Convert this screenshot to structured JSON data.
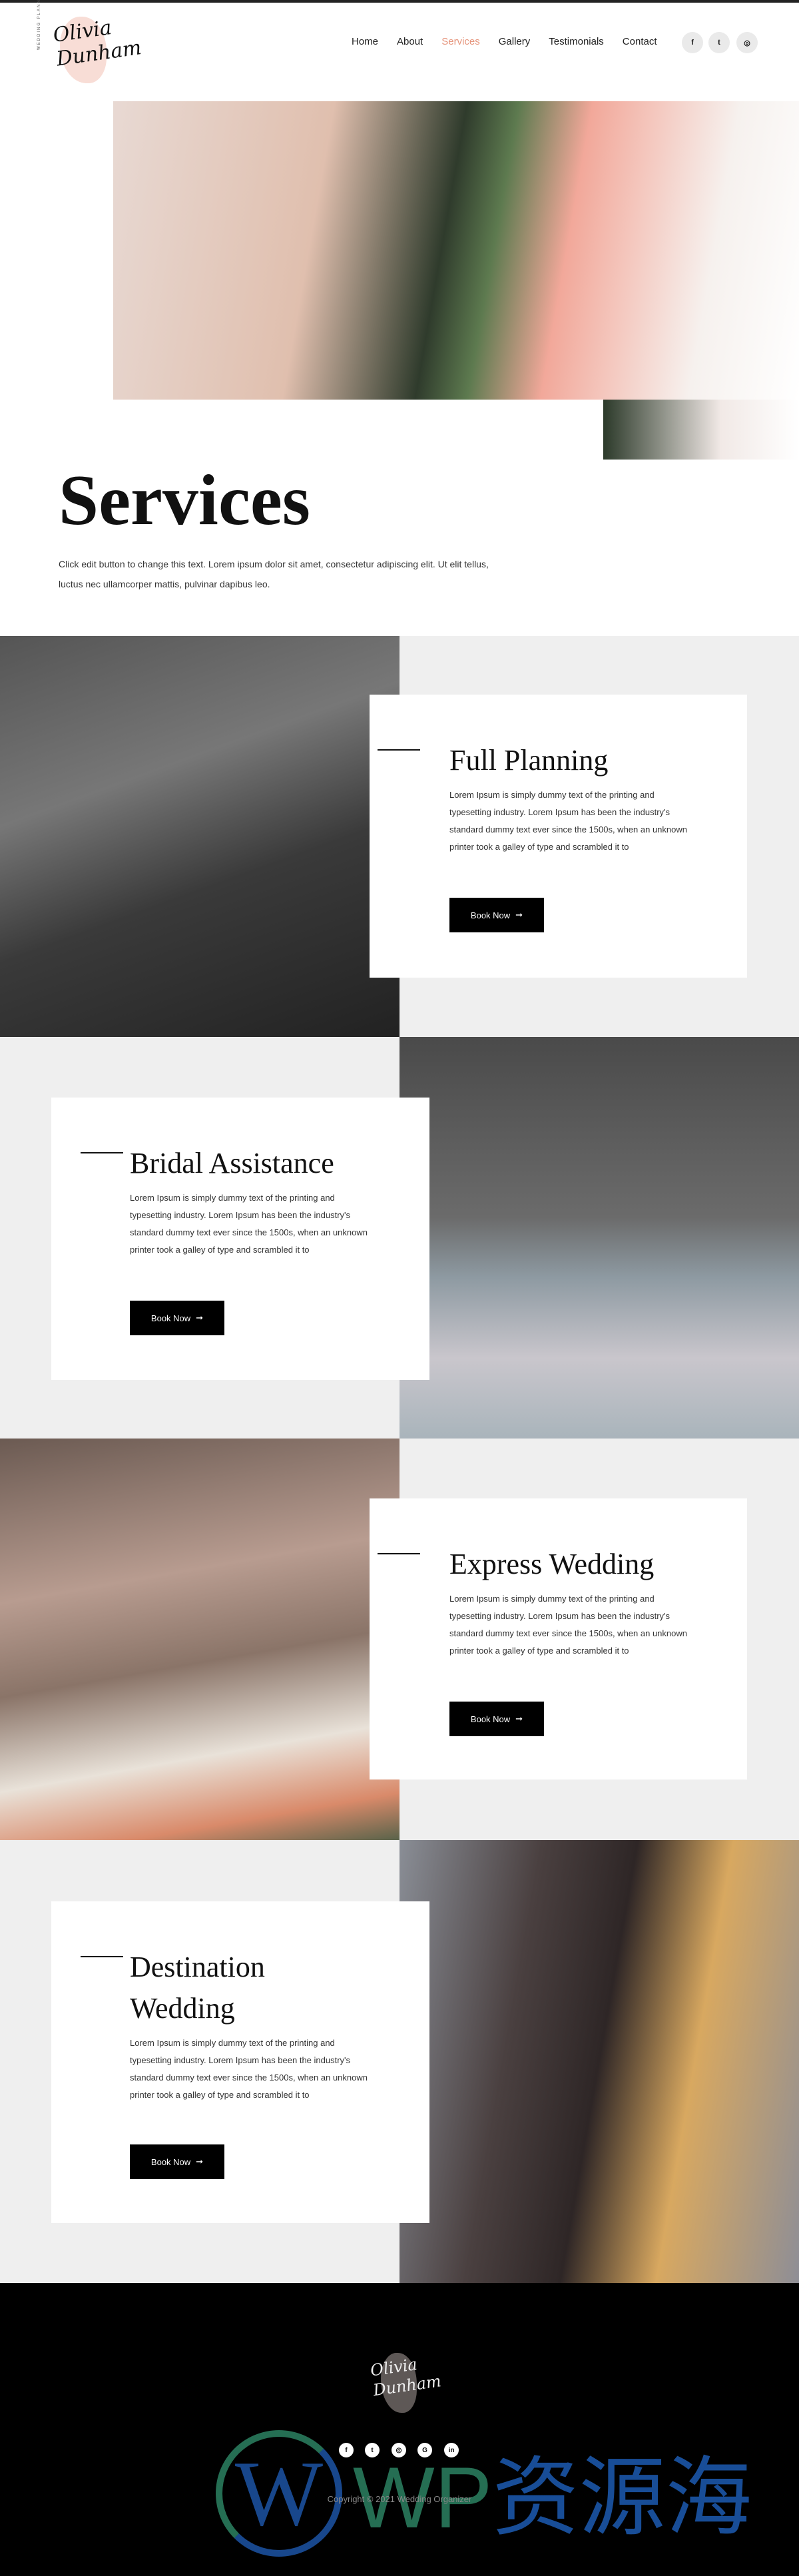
{
  "header": {
    "logo": {
      "script": "Olivia Dunham",
      "tagline": "WEDDING PLANNER"
    },
    "nav": [
      {
        "label": "Home"
      },
      {
        "label": "About"
      },
      {
        "label": "Services",
        "active": true
      },
      {
        "label": "Gallery"
      },
      {
        "label": "Testimonials"
      },
      {
        "label": "Contact"
      }
    ],
    "social": [
      {
        "icon": "facebook-icon",
        "glyph": "f"
      },
      {
        "icon": "twitter-icon",
        "glyph": "t"
      },
      {
        "icon": "instagram-icon",
        "glyph": "◎"
      }
    ],
    "accent": "#e6957c"
  },
  "page": {
    "title": "Services",
    "intro": "Click edit button to change this text. Lorem ipsum dolor sit amet, consectetur adipiscing elit. Ut elit tellus, luctus nec ullamcorper mattis, pulvinar dapibus leo."
  },
  "services": [
    {
      "title": "Full Planning",
      "text": "Lorem Ipsum is simply dummy text of the printing and typesetting industry. Lorem Ipsum has been the industry's standard dummy text ever since the 1500s, when an unknown printer took a galley of type and scrambled it to",
      "button": "Book Now",
      "arrow": "➞"
    },
    {
      "title": "Bridal Assistance",
      "text": "Lorem Ipsum is simply dummy text of the printing and typesetting industry. Lorem Ipsum has been the industry's standard dummy text ever since the 1500s, when an unknown printer took a galley of type and scrambled it to",
      "button": "Book Now",
      "arrow": "➞"
    },
    {
      "title": "Express Wedding",
      "text": "Lorem Ipsum is simply dummy text of the printing and typesetting industry. Lorem Ipsum has been the industry's standard dummy text ever since the 1500s, when an unknown printer took a galley of type and scrambled it to",
      "button": "Book Now",
      "arrow": "➞"
    },
    {
      "title": "Destination Wedding",
      "text": "Lorem Ipsum is simply dummy text of the printing and typesetting industry. Lorem Ipsum has been the industry's standard dummy text ever since the 1500s, when an unknown printer took a galley of type and scrambled it to",
      "button": "Book Now",
      "arrow": "➞"
    }
  ],
  "footer": {
    "logo": {
      "script": "Olivia Dunham"
    },
    "social": [
      {
        "icon": "facebook-icon",
        "glyph": "f"
      },
      {
        "icon": "twitter-icon",
        "glyph": "t"
      },
      {
        "icon": "instagram-icon",
        "glyph": "◎"
      },
      {
        "icon": "google-icon",
        "glyph": "G"
      },
      {
        "icon": "linkedin-icon",
        "glyph": "in"
      }
    ],
    "copyright": "Copyright © 2021 Wedding Organizer"
  },
  "watermark": {
    "latin": "WP",
    "cjk": "资源海",
    "mark": "W"
  }
}
